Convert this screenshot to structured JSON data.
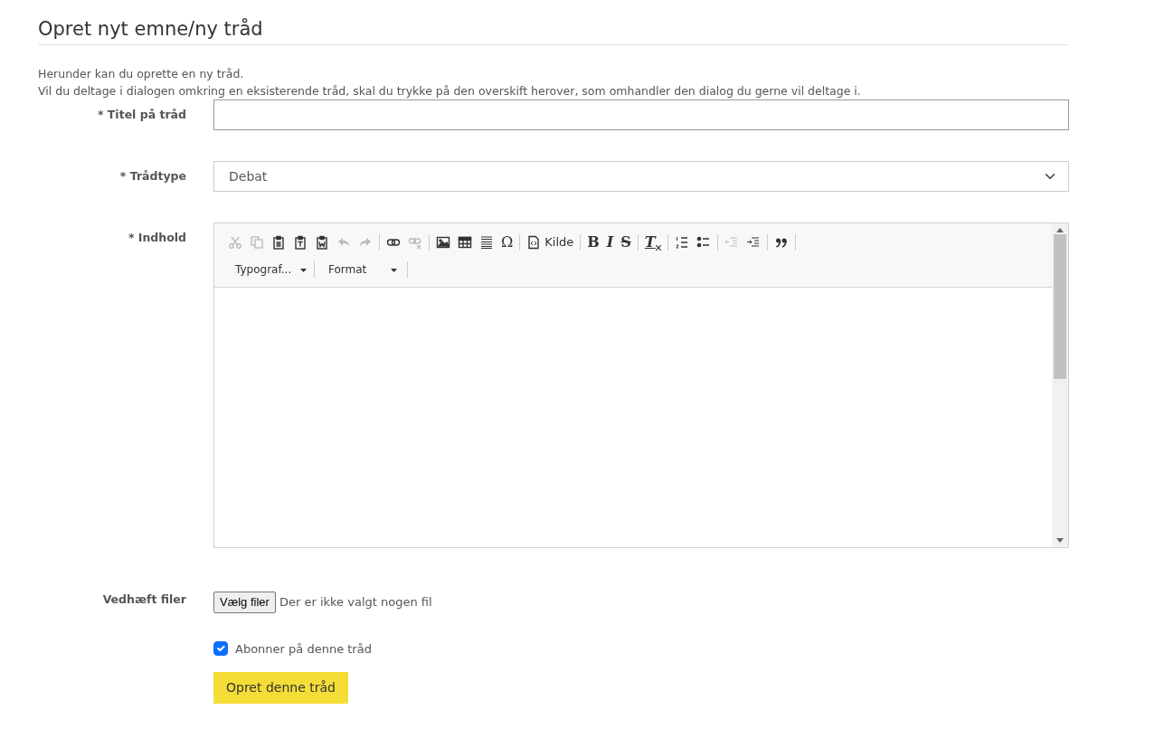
{
  "heading": "Opret nyt emne/ny tråd",
  "intro": [
    "Herunder kan du oprette en ny tråd.",
    "Vil du deltage i dialogen omkring en eksisterende tråd, skal du trykke på den overskift herover, som omhandler den dialog du gerne vil deltage i."
  ],
  "fields": [
    {
      "kind": "text",
      "label": "* Titel på tråd"
    },
    {
      "kind": "select",
      "label": "* Trådtype",
      "value": "Debat"
    },
    {
      "kind": "editor",
      "label": "* Indhold"
    },
    {
      "kind": "file",
      "label": "Vedhæft filer",
      "button": "Vælg filer",
      "status": "Der er ikke valgt nogen fil"
    }
  ],
  "toolbar": [
    [
      {
        "kind": "cut",
        "disabled": true
      },
      {
        "kind": "copy",
        "disabled": true
      },
      {
        "kind": "paste",
        "disabled": false
      },
      {
        "kind": "paste-text",
        "disabled": false
      },
      {
        "kind": "paste-word",
        "disabled": false
      },
      {
        "kind": "undo",
        "disabled": true
      },
      {
        "kind": "redo",
        "disabled": true
      }
    ],
    [
      {
        "kind": "link",
        "disabled": false
      },
      {
        "kind": "unlink",
        "disabled": true
      }
    ],
    [
      {
        "kind": "image",
        "disabled": false
      },
      {
        "kind": "table",
        "disabled": false
      },
      {
        "kind": "rule",
        "disabled": false
      },
      {
        "kind": "special-char",
        "glyph": "Ω",
        "disabled": false
      }
    ],
    [
      {
        "kind": "source",
        "label": "Kilde",
        "disabled": false
      }
    ],
    [
      {
        "kind": "bold",
        "glyph": "B",
        "disabled": false
      },
      {
        "kind": "italic",
        "glyph": "I",
        "disabled": false
      },
      {
        "kind": "strike",
        "glyph": "S",
        "disabled": false
      }
    ],
    [
      {
        "kind": "clear-format",
        "glyph": "T",
        "disabled": false
      }
    ],
    [
      {
        "kind": "ordered-list",
        "disabled": false
      },
      {
        "kind": "bullet-list",
        "disabled": false
      }
    ],
    [
      {
        "kind": "outdent",
        "disabled": true
      },
      {
        "kind": "indent",
        "disabled": false
      }
    ],
    [
      {
        "kind": "quote",
        "disabled": false
      }
    ]
  ],
  "combos": [
    "Typograf...",
    "Format"
  ],
  "subscribe": {
    "label": "Abonner på denne tråd",
    "checked": true
  },
  "submit": "Opret denne tråd"
}
